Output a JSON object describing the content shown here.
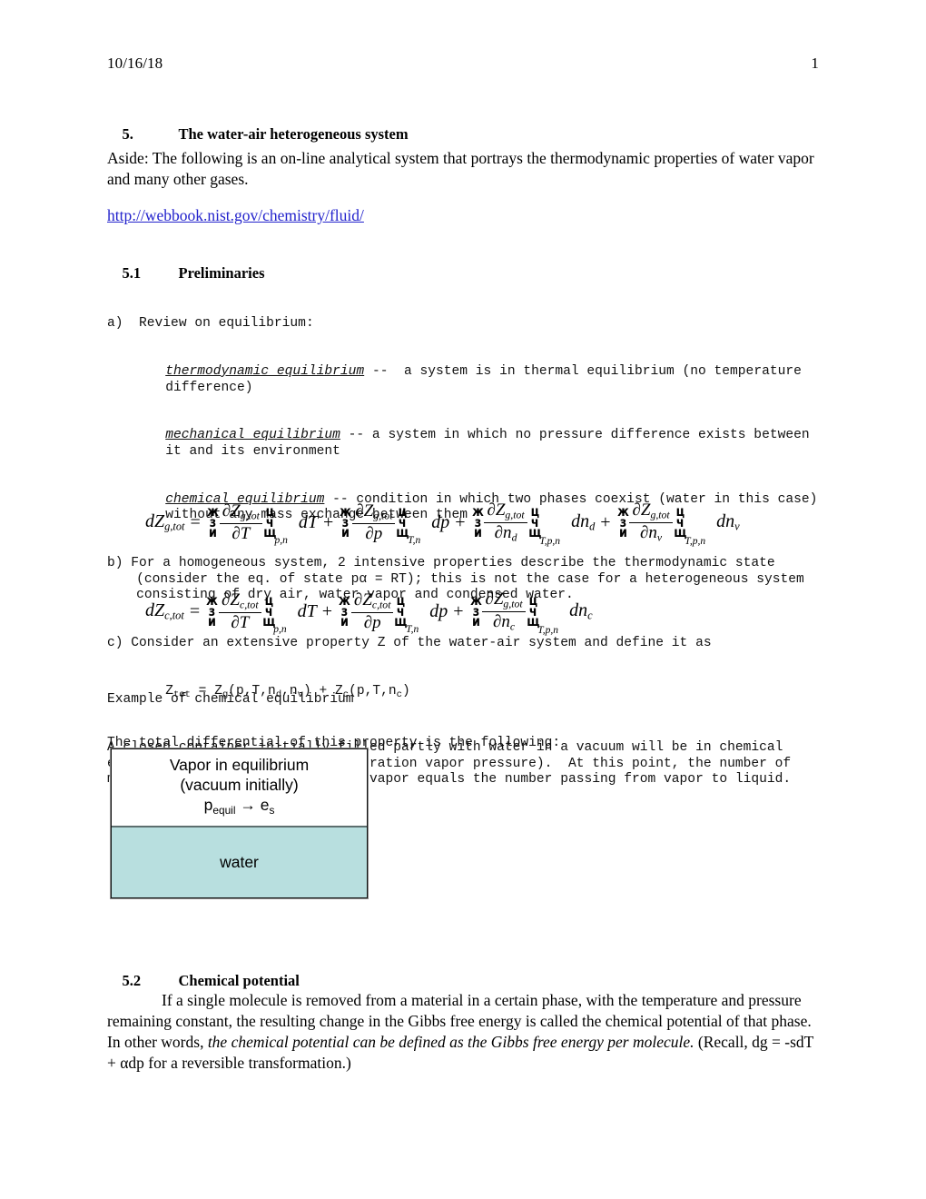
{
  "header": {
    "date": "10/16/18",
    "page_number": "1"
  },
  "sections": {
    "s5_num": "5.",
    "s5_title": "The water-air heterogeneous system",
    "aside": "Aside:  The following is an on-line analytical system that portrays the thermodynamic properties of water vapor and many other gases.",
    "link_text": "http://webbook.nist.gov/chemistry/fluid/",
    "s51_num": "5.1",
    "s51_title": "Preliminaries",
    "s52_num": "5.2",
    "s52_title": "Chemical potential"
  },
  "preliminaries": {
    "a_label": "a)",
    "a_intro": "Review on equilibrium:",
    "term1": "thermodynamic equilibrium",
    "term1_def": " --  a system is in thermal equilibrium (no temperature difference)",
    "term2": "mechanical equilibrium",
    "term2_def": " -- a system in which no pressure difference exists between it and its environment",
    "term3": "chemical equilibrium",
    "term3_def": " -- condition in which two phases coexist (water in this case) without any mass exchange between them",
    "b_label": "b)",
    "b_text": "For a homogeneous system, 2 intensive properties describe the thermodynamic state (consider the eq. of state pα = RT); this is not the case for a heterogeneous system consisting of dry air, water vapor and condensed water.",
    "c_label": "c)",
    "c_text": "Consider an extensive property Z of the water-air system and define it as",
    "c_formula_parts": {
      "z": "Z",
      "tot": "tot",
      "eq": " = ",
      "zg": "Z",
      "g": "g",
      "args_g_open": "(p,T,n",
      "d": "d",
      "comma": ",n",
      "v": "v",
      "args_g_close": ")",
      "plus": " + ",
      "zc": "Z",
      "c": "c",
      "args_c_open": "(p,T,n",
      "c2": "c",
      "args_c_close": ")"
    },
    "total_diff": "The total differential of this property is the following:"
  },
  "equations": {
    "eq1": {
      "lhs": "dZ",
      "lhs_sub": "g,tot",
      "equals": "=",
      "terms": [
        {
          "numer": "∂Z",
          "numer_sub": "g,tot",
          "denom": "∂T",
          "denom_sub": "",
          "bracket_sub": "p,n",
          "differential": "dT",
          "differential_sub": "",
          "op": ""
        },
        {
          "numer": "∂Z",
          "numer_sub": "g,tot",
          "denom": "∂p",
          "denom_sub": "",
          "bracket_sub": "T,n",
          "differential": "dp",
          "differential_sub": "",
          "op": "+"
        },
        {
          "numer": "∂Z",
          "numer_sub": "g,tot",
          "denom": "∂n",
          "denom_sub": "d",
          "bracket_sub": "T,p,n",
          "differential": "dn",
          "differential_sub": "d",
          "op": "+"
        },
        {
          "numer": "∂Z",
          "numer_sub": "g,tot",
          "denom": "∂n",
          "denom_sub": "v",
          "bracket_sub": "T,p,n",
          "differential": "dn",
          "differential_sub": "v",
          "op": "+"
        }
      ]
    },
    "eq2": {
      "lhs": "dZ",
      "lhs_sub": "c,tot",
      "equals": "=",
      "terms": [
        {
          "numer": "∂Z",
          "numer_sub": "c,tot",
          "denom": "∂T",
          "denom_sub": "",
          "bracket_sub": "p,n",
          "differential": "dT",
          "differential_sub": "",
          "op": ""
        },
        {
          "numer": "∂Z",
          "numer_sub": "c,tot",
          "denom": "∂p",
          "denom_sub": "",
          "bracket_sub": "T,n",
          "differential": "dp",
          "differential_sub": "",
          "op": "+"
        },
        {
          "numer": "∂Z",
          "numer_sub": "g,tot",
          "denom": "∂n",
          "denom_sub": "c",
          "bracket_sub": "T,p,n",
          "differential": "dn",
          "differential_sub": "c",
          "op": "+"
        }
      ]
    },
    "bracket_glyphs": {
      "left": [
        "ж",
        "з",
        "и"
      ],
      "right": [
        "ц",
        "ч",
        "щ"
      ]
    }
  },
  "example": {
    "title": "Example of chemical equilibrium",
    "body": "A closed container initially filled partly with water in a vacuum will be in chemical equilibrium when p = es (the saturation vapor pressure).  At this point, the number of molecules passing from liquid to vapor equals the number passing from vapor to liquid."
  },
  "diagram": {
    "vapor_line1": "Vapor in equilibrium",
    "vapor_line2": "(vacuum initially)",
    "vapor_p": "p",
    "vapor_p_sub": "equil",
    "vapor_arrow": " → ",
    "vapor_e": "e",
    "vapor_e_sub": "s",
    "water_label": "water",
    "water_color": "#b8dfdf",
    "border_color": "#111111"
  },
  "chemical_potential": {
    "para_part1": "If a single molecule is removed from a material in a certain phase, with the temperature and pressure remaining constant, the resulting change in the Gibbs free energy is called the chemical potential of that phase.  In other words",
    "comma": ", ",
    "italic_part": "the chemical potential can be defined as the Gibbs free energy per molecule.",
    "para_part2": "  (Recall, dg = -sdT + αdp for a reversible transformation.)"
  }
}
